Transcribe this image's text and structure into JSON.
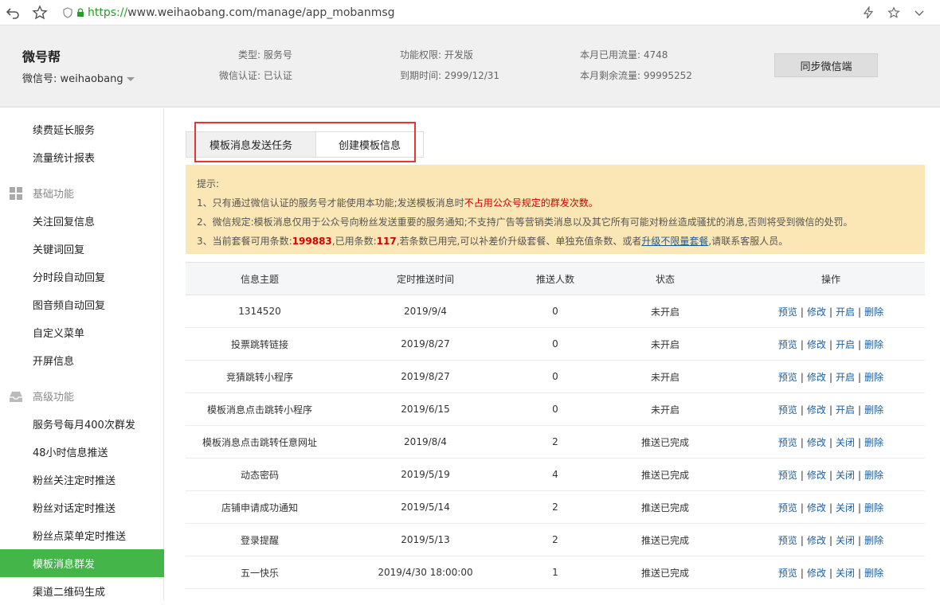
{
  "browser": {
    "url_proto": "https://",
    "url_rest": "www.weihaobang.com/manage/app_mobanmsg"
  },
  "header": {
    "brand": "微号帮",
    "account_label": "微信号: weihaobang",
    "type_label": "类型: 服务号",
    "verify_label": "微信认证: 已认证",
    "perm_label": "功能权限: 开发版",
    "expire_label": "到期时间: 2999/12/31",
    "used_flow_label": "本月已用流量: 4748",
    "remain_flow_label": "本月剩余流量: 99995252",
    "sync_button": "同步微信端"
  },
  "sidebar": {
    "items": [
      {
        "label": "续费延长服务"
      },
      {
        "label": "流量统计报表"
      },
      {
        "label": "关注回复信息"
      },
      {
        "label": "关键词回复"
      },
      {
        "label": "分时段自动回复"
      },
      {
        "label": "图音频自动回复"
      },
      {
        "label": "自定义菜单"
      },
      {
        "label": "开屏信息"
      },
      {
        "label": "服务号每月400次群发"
      },
      {
        "label": "48小时信息推送"
      },
      {
        "label": "粉丝关注定时推送"
      },
      {
        "label": "粉丝对话定时推送"
      },
      {
        "label": "粉丝点菜单定时推送"
      },
      {
        "label": "模板消息群发"
      },
      {
        "label": "渠道二维码生成"
      }
    ],
    "sections": [
      {
        "label": "基础功能"
      },
      {
        "label": "高级功能"
      }
    ]
  },
  "tabs": [
    {
      "label": "模板消息发送任务"
    },
    {
      "label": "创建模板信息"
    }
  ],
  "tips": {
    "title": "提示:",
    "line1_a": "1、只有通过微信认证的服务号才能使用本功能;发送模板消息时",
    "line1_warn": "不占用公众号规定的群发次数。",
    "line2": "2、微信规定:模板消息仅用于公众号向粉丝发送重要的服务通知;不支持广告等营销类消息以及其它所有可能对粉丝造成骚扰的消息,否则将受到微信的处罚。",
    "line3_a": "3、当前套餐可用条数:",
    "line3_avail": "199883",
    "line3_b": ",已用条数:",
    "line3_used": "117",
    "line3_c": ",若条数已用完,可以补差价升级套餐、单独充值条数、或者",
    "line3_link": "升级不限量套餐",
    "line3_d": ",请联系客服人员。"
  },
  "table": {
    "headers": [
      "信息主题",
      "定时推送时间",
      "推送人数",
      "状态",
      "操作"
    ],
    "op_labels": {
      "preview": "预览",
      "edit": "修改",
      "open": "开启",
      "close": "关闭",
      "delete": "删除"
    },
    "rows": [
      {
        "subject": "1314520",
        "time": "2019/9/4",
        "count": "0",
        "status": "未开启"
      },
      {
        "subject": "投票跳转链接",
        "time": "2019/8/27",
        "count": "0",
        "status": "未开启"
      },
      {
        "subject": "竞猜跳转小程序",
        "time": "2019/8/27",
        "count": "0",
        "status": "未开启"
      },
      {
        "subject": "模板消息点击跳转小程序",
        "time": "2019/6/15",
        "count": "0",
        "status": "未开启"
      },
      {
        "subject": "模板消息点击跳转任意网址",
        "time": "2019/8/4",
        "count": "2",
        "status": "推送已完成"
      },
      {
        "subject": "动态密码",
        "time": "2019/5/19",
        "count": "4",
        "status": "推送已完成"
      },
      {
        "subject": "店铺申请成功通知",
        "time": "2019/5/14",
        "count": "2",
        "status": "推送已完成"
      },
      {
        "subject": "登录提醒",
        "time": "2019/5/13",
        "count": "2",
        "status": "推送已完成"
      },
      {
        "subject": "五一快乐",
        "time": "2019/4/30 18:00:00",
        "count": "1",
        "status": "推送已完成"
      }
    ]
  },
  "colors": {
    "accent": "#44b549",
    "tip_bg": "#fbe6b6",
    "status_off": "#c51a1a",
    "status_done": "#d8a300",
    "link": "#1a5e9c"
  }
}
